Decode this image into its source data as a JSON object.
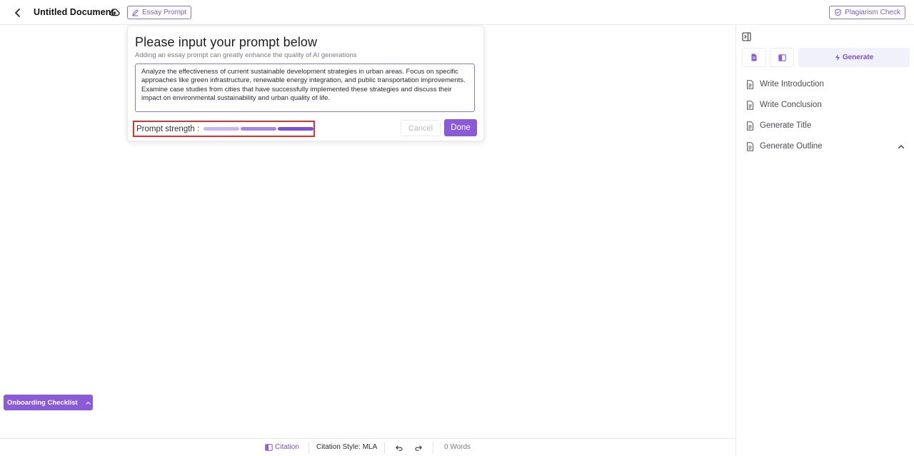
{
  "header": {
    "document_title": "Untitled Document",
    "essay_prompt_label": "Essay Prompt",
    "plagiarism_label": "Plagiarism Check"
  },
  "prompt_card": {
    "title": "Please input your prompt below",
    "subtitle": "Adding an essay prompt can greatly enhance the quality of AI generations",
    "prompt_text": "Analyze the effectiveness of current sustainable development strategies in urban areas. Focus on specific approaches like green infrastructure, renewable energy integration, and public transportation improvements. Examine case studies from cities that have successfully implemented these strategies and discuss their impact on environmental sustainability and urban quality of life.",
    "strength_label": "Prompt strength :",
    "strength_level": 3,
    "strength_max": 3,
    "cancel_label": "Cancel",
    "done_label": "Done"
  },
  "right_panel": {
    "generate_tab_label": "Generate",
    "actions": [
      {
        "label": "Write Introduction",
        "icon": "document-icon"
      },
      {
        "label": "Write Conclusion",
        "icon": "document-icon"
      },
      {
        "label": "Generate Title",
        "icon": "document-icon"
      },
      {
        "label": "Generate Outline",
        "icon": "document-icon"
      }
    ]
  },
  "onboarding": {
    "label": "Onboarding Checklist"
  },
  "footer": {
    "citation_label": "Citation",
    "citation_style_label": "Citation Style:",
    "citation_style_value": "MLA",
    "word_count": "0 Words"
  },
  "colors": {
    "accent": "#8b5ad8",
    "accent_text": "#7b4fd1",
    "highlight_border": "#e03131",
    "strength_bar_1": "#c9b5f5",
    "strength_bar_2": "#a585ec",
    "strength_bar_3": "#7b4fd8"
  }
}
